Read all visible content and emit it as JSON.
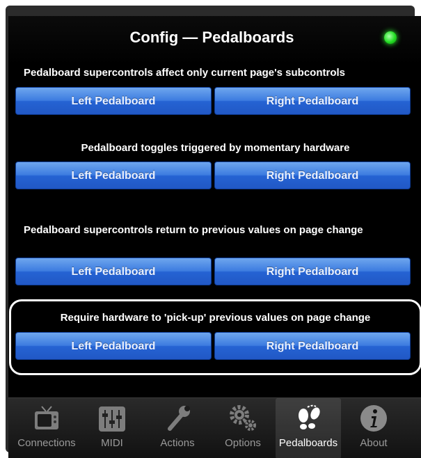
{
  "header": {
    "title": "Config — Pedalboards"
  },
  "sections": [
    {
      "label": "Pedalboard supercontrols affect only current page's subcontrols",
      "left": "Left Pedalboard",
      "right": "Right Pedalboard"
    },
    {
      "label": "Pedalboard toggles triggered by momentary hardware",
      "left": "Left Pedalboard",
      "right": "Right Pedalboard"
    },
    {
      "label": "Pedalboard supercontrols return to previous values on page change",
      "left": "Left Pedalboard",
      "right": "Right Pedalboard"
    },
    {
      "label": "Require hardware to 'pick-up' previous values on page change",
      "left": "Left Pedalboard",
      "right": "Right Pedalboard"
    }
  ],
  "tabs": [
    {
      "label": "Connections",
      "icon": "tv-icon"
    },
    {
      "label": "MIDI",
      "icon": "mixer-sliders-icon"
    },
    {
      "label": "Actions",
      "icon": "wrench-icon"
    },
    {
      "label": "Options",
      "icon": "gears-icon"
    },
    {
      "label": "Pedalboards",
      "icon": "footprints-icon",
      "active": true
    },
    {
      "label": "About",
      "icon": "info-icon"
    }
  ],
  "colors": {
    "status_led": "#22dd22",
    "button": "#2f6ee0",
    "highlight": "#ffffff"
  }
}
